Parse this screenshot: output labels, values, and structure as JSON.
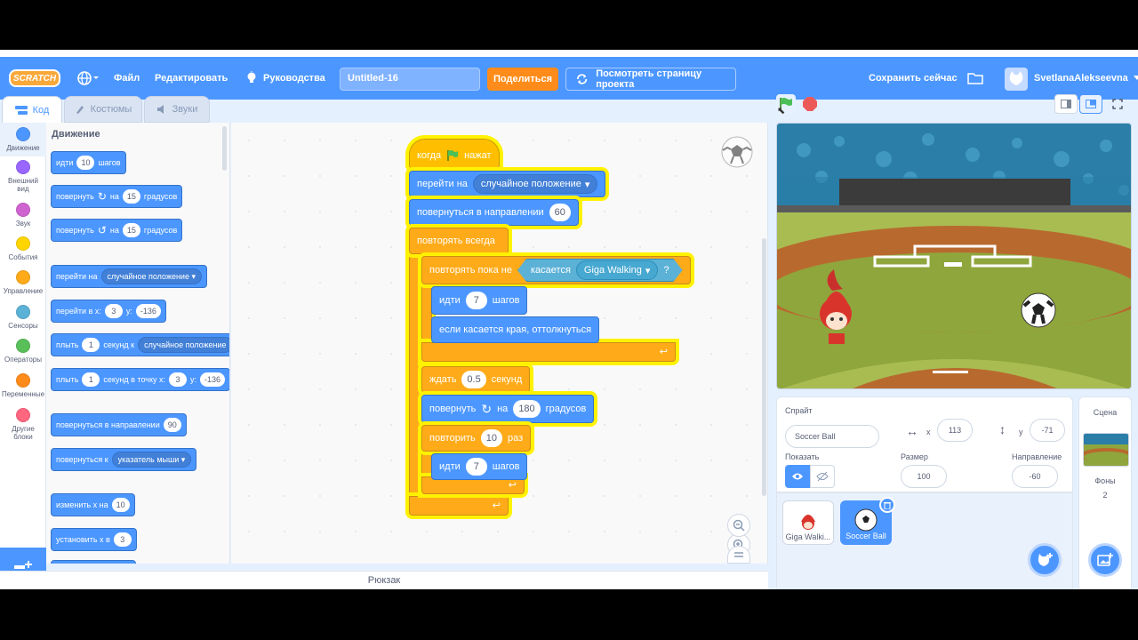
{
  "menu": {
    "logo": "SCRATCH",
    "file": "Файл",
    "edit": "Редактировать",
    "tutorials": "Руководства",
    "project_title": "Untitled-16",
    "share": "Поделиться",
    "see_project_page": "Посмотреть страницу проекта",
    "save_now": "Сохранить сейчас",
    "username": "SvetlanaAlekseevna"
  },
  "tabs": {
    "code": "Код",
    "costumes": "Костюмы",
    "sounds": "Звуки"
  },
  "categories": [
    {
      "label": "Движение",
      "color": "#4c97ff"
    },
    {
      "label": "Внешний вид",
      "color": "#9966ff"
    },
    {
      "label": "Звук",
      "color": "#cf63cf"
    },
    {
      "label": "События",
      "color": "#ffd500"
    },
    {
      "label": "Управление",
      "color": "#ffab19"
    },
    {
      "label": "Сенсоры",
      "color": "#5cb1d6"
    },
    {
      "label": "Операторы",
      "color": "#59c059"
    },
    {
      "label": "Переменные",
      "color": "#ff8c1a"
    },
    {
      "label": "Другие блоки",
      "color": "#ff6680"
    }
  ],
  "palette": {
    "title": "Движение",
    "move": {
      "a": "идти",
      "v": "10",
      "b": "шагов"
    },
    "turn_right": {
      "a": "повернуть",
      "b": "на",
      "v": "15",
      "c": "градусов"
    },
    "turn_left": {
      "a": "повернуть",
      "b": "на",
      "v": "15",
      "c": "градусов"
    },
    "goto": {
      "a": "перейти на",
      "dd": "случайное положение"
    },
    "goto_xy": {
      "a": "перейти в x:",
      "x": "3",
      "b": "y:",
      "y": "-136"
    },
    "glide": {
      "a": "плыть",
      "v": "1",
      "b": "секунд к",
      "dd": "случайное положение"
    },
    "glide_xy": {
      "a": "плыть",
      "v": "1",
      "b": "секунд в точку x:",
      "x": "3",
      "c": "y:",
      "y": "-136"
    },
    "point_dir": {
      "a": "повернуться в направлении",
      "v": "90"
    },
    "point_towards": {
      "a": "повернуться к",
      "dd": "указатель мыши"
    },
    "change_x": {
      "a": "изменить х на",
      "v": "10"
    },
    "set_x": {
      "a": "установить х в",
      "v": "3"
    }
  },
  "script": {
    "hat": {
      "a": "когда",
      "b": "нажат"
    },
    "goto": {
      "a": "перейти на",
      "dd": "случайное положение"
    },
    "point": {
      "a": "повернуться в направлении",
      "v": "60"
    },
    "forever": "повторять всегда",
    "repeat_until": {
      "a": "повторять пока не",
      "b": "касается",
      "dd": "Giga Walking",
      "q": "?"
    },
    "move1": {
      "a": "идти",
      "v": "7",
      "b": "шагов"
    },
    "bounce": "если касается края, оттолкнуться",
    "wait": {
      "a": "ждать",
      "v": "0.5",
      "b": "секунд"
    },
    "turn": {
      "a": "повернуть",
      "b": "на",
      "v": "180",
      "c": "градусов"
    },
    "repeat": {
      "a": "повторить",
      "v": "10",
      "b": "раз"
    },
    "move2": {
      "a": "идти",
      "v": "7",
      "b": "шагов"
    }
  },
  "backpack": "Рюкзак",
  "sprite_info": {
    "sprite_label": "Спрайт",
    "sprite_name": "Soccer Ball",
    "x_label": "x",
    "x": "113",
    "y_label": "y",
    "y": "-71",
    "show_label": "Показать",
    "size_label": "Размер",
    "size": "100",
    "direction_label": "Направление",
    "direction": "-60"
  },
  "sprites": [
    {
      "name": "Giga Walki..."
    },
    {
      "name": "Soccer Ball"
    }
  ],
  "stage_panel": {
    "label": "Сцена",
    "backdrops_label": "Фоны",
    "backdrops_count": "2"
  }
}
